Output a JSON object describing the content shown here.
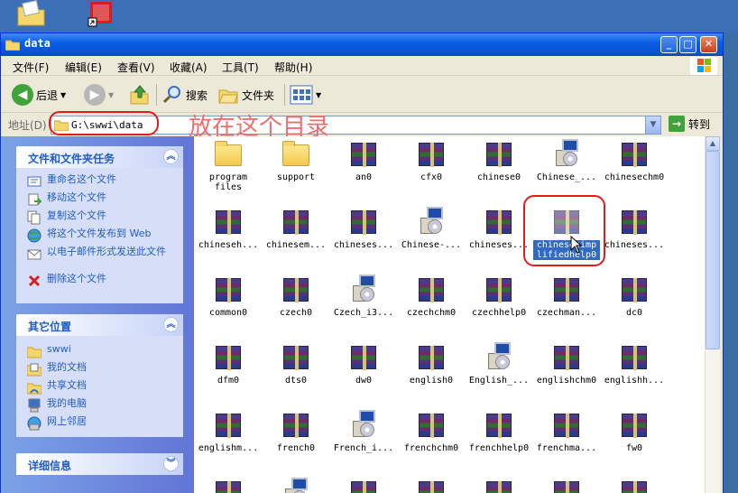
{
  "window": {
    "title": "data"
  },
  "menu": [
    {
      "label": "文件(F)"
    },
    {
      "label": "编辑(E)"
    },
    {
      "label": "查看(V)"
    },
    {
      "label": "收藏(A)"
    },
    {
      "label": "工具(T)"
    },
    {
      "label": "帮助(H)"
    }
  ],
  "toolbar": {
    "back_label": "后退",
    "search_label": "搜索",
    "folders_label": "文件夹"
  },
  "address": {
    "label": "地址(D)",
    "value": "G:\\swwi\\data",
    "go_label": "转到"
  },
  "annotation": {
    "note": "放在这个目录"
  },
  "sidebar": {
    "tasks": {
      "title": "文件和文件夹任务",
      "items": [
        {
          "label": "重命名这个文件",
          "icon": "rename-icon"
        },
        {
          "label": "移动这个文件",
          "icon": "move-icon"
        },
        {
          "label": "复制这个文件",
          "icon": "copy-icon"
        },
        {
          "label": "将这个文件发布到 Web",
          "icon": "web-publish-icon"
        },
        {
          "label": "以电子邮件形式发送此文件",
          "icon": "email-icon"
        },
        {
          "label": "删除这个文件",
          "icon": "delete-icon"
        }
      ]
    },
    "places": {
      "title": "其它位置",
      "items": [
        {
          "label": "swwi",
          "icon": "folder-icon"
        },
        {
          "label": "我的文档",
          "icon": "my-documents-icon"
        },
        {
          "label": "共享文档",
          "icon": "shared-documents-icon"
        },
        {
          "label": "我的电脑",
          "icon": "my-computer-icon"
        },
        {
          "label": "网上邻居",
          "icon": "network-icon"
        }
      ]
    },
    "details": {
      "title": "详细信息"
    }
  },
  "files": [
    {
      "name": "program\nfiles",
      "type": "folder"
    },
    {
      "name": "support",
      "type": "folder"
    },
    {
      "name": "an0",
      "type": "rar"
    },
    {
      "name": "cfx0",
      "type": "rar"
    },
    {
      "name": "chinese0",
      "type": "rar"
    },
    {
      "name": "Chinese_...",
      "type": "setup"
    },
    {
      "name": "chinesechm0",
      "type": "rar"
    },
    {
      "name": "chineseh...",
      "type": "rar"
    },
    {
      "name": "chinesem...",
      "type": "rar"
    },
    {
      "name": "chineses...",
      "type": "rar"
    },
    {
      "name": "Chinese-...",
      "type": "setup"
    },
    {
      "name": "chineses...",
      "type": "rar"
    },
    {
      "name": "chinesesimp\nlifiedhelp0",
      "type": "rar",
      "selected": true
    },
    {
      "name": "chineses...",
      "type": "rar"
    },
    {
      "name": "common0",
      "type": "rar"
    },
    {
      "name": "czech0",
      "type": "rar"
    },
    {
      "name": "Czech_i3...",
      "type": "setup"
    },
    {
      "name": "czechchm0",
      "type": "rar"
    },
    {
      "name": "czechhelp0",
      "type": "rar"
    },
    {
      "name": "czechman...",
      "type": "rar"
    },
    {
      "name": "dc0",
      "type": "rar"
    },
    {
      "name": "dfm0",
      "type": "rar"
    },
    {
      "name": "dts0",
      "type": "rar"
    },
    {
      "name": "dw0",
      "type": "rar"
    },
    {
      "name": "english0",
      "type": "rar"
    },
    {
      "name": "English_...",
      "type": "setup"
    },
    {
      "name": "englishchm0",
      "type": "rar"
    },
    {
      "name": "englishh...",
      "type": "rar"
    },
    {
      "name": "englishm...",
      "type": "rar"
    },
    {
      "name": "french0",
      "type": "rar"
    },
    {
      "name": "French_i...",
      "type": "setup"
    },
    {
      "name": "frenchchm0",
      "type": "rar"
    },
    {
      "name": "frenchhelp0",
      "type": "rar"
    },
    {
      "name": "frenchma...",
      "type": "rar"
    },
    {
      "name": "fw0",
      "type": "rar"
    },
    {
      "name": "",
      "type": "rar"
    },
    {
      "name": "",
      "type": "setup"
    },
    {
      "name": "",
      "type": "rar"
    },
    {
      "name": "",
      "type": "rar"
    },
    {
      "name": "",
      "type": "rar"
    },
    {
      "name": "",
      "type": "rar"
    },
    {
      "name": "",
      "type": "rar"
    }
  ],
  "colors": {
    "title_bar": "#0a5fe5",
    "sidebar": "#6f8fe0",
    "link_blue": "#215dc6",
    "selection": "#316ac5",
    "annotation_red": "#e31b1b"
  }
}
